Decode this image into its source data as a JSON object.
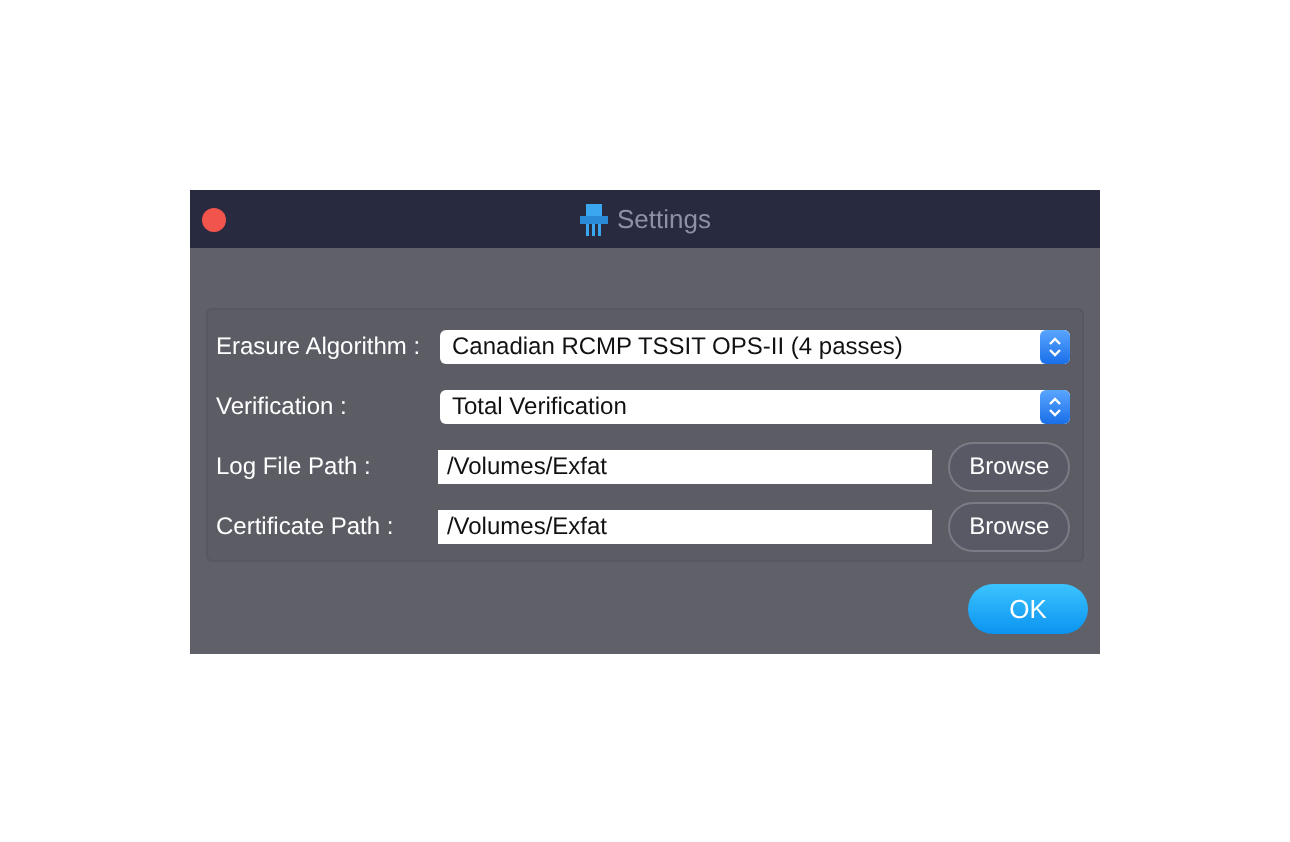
{
  "window": {
    "title": "Settings"
  },
  "rows": [
    {
      "kind": "select",
      "label": "Erasure Algorithm :",
      "value": "Canadian RCMP TSSIT OPS-II (4 passes)"
    },
    {
      "kind": "select",
      "label": "Verification :",
      "value": "Total Verification"
    },
    {
      "kind": "path",
      "label": "Log File Path :",
      "value": "/Volumes/Exfat",
      "button": "Browse"
    },
    {
      "kind": "path",
      "label": "Certificate Path :",
      "value": "/Volumes/Exfat",
      "button": "Browse"
    }
  ],
  "buttons": [
    "OK"
  ]
}
